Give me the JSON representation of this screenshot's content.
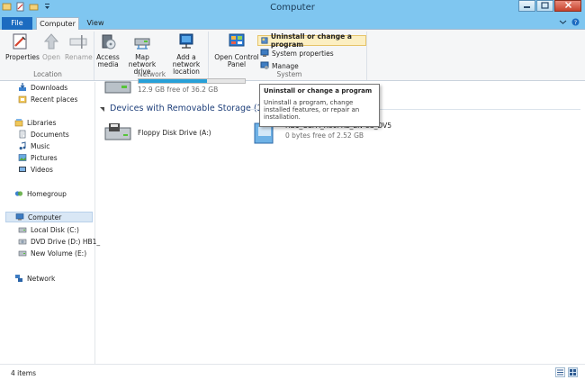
{
  "window": {
    "title": "Computer"
  },
  "tabs": {
    "file": "File",
    "computer": "Computer",
    "view": "View"
  },
  "ribbon": {
    "location": {
      "label": "Location",
      "properties": "Properties",
      "open": "Open",
      "rename": "Rename"
    },
    "network": {
      "label": "Network",
      "access_media": "Access media",
      "map_network_drive": "Map network drive",
      "add_network_location": "Add a network location"
    },
    "system": {
      "label": "System",
      "open_control_panel": "Open Control Panel",
      "uninstall": "Uninstall or change a program",
      "system_properties": "System properties",
      "manage": "Manage"
    }
  },
  "nav": {
    "downloads": "Downloads",
    "recent_places": "Recent places",
    "libraries": "Libraries",
    "documents": "Documents",
    "music": "Music",
    "pictures": "Pictures",
    "videos": "Videos",
    "homegroup": "Homegroup",
    "computer": "Computer",
    "local_disk": "Local Disk (C:)",
    "dvd_drive": "DVD Drive (D:) HB1_",
    "new_volume": "New Volume (E:)",
    "network": "Network"
  },
  "main": {
    "partial_drive": {
      "free": "12.9 GB free of 36.2 GB",
      "used_fraction": 0.64
    },
    "removable_header": "Devices with Removable Storage (2)",
    "floppy": {
      "name": "Floppy Disk Drive (A:)"
    },
    "dvd": {
      "name": "HB1_CCPA_X86FRE_EN-US_DV5",
      "free": "0 bytes free of 2.52 GB"
    }
  },
  "tooltip": {
    "title": "Uninstall or change a program",
    "body": "Uninstall a program, change installed features, or repair an installation."
  },
  "status": {
    "items": "4 items"
  }
}
